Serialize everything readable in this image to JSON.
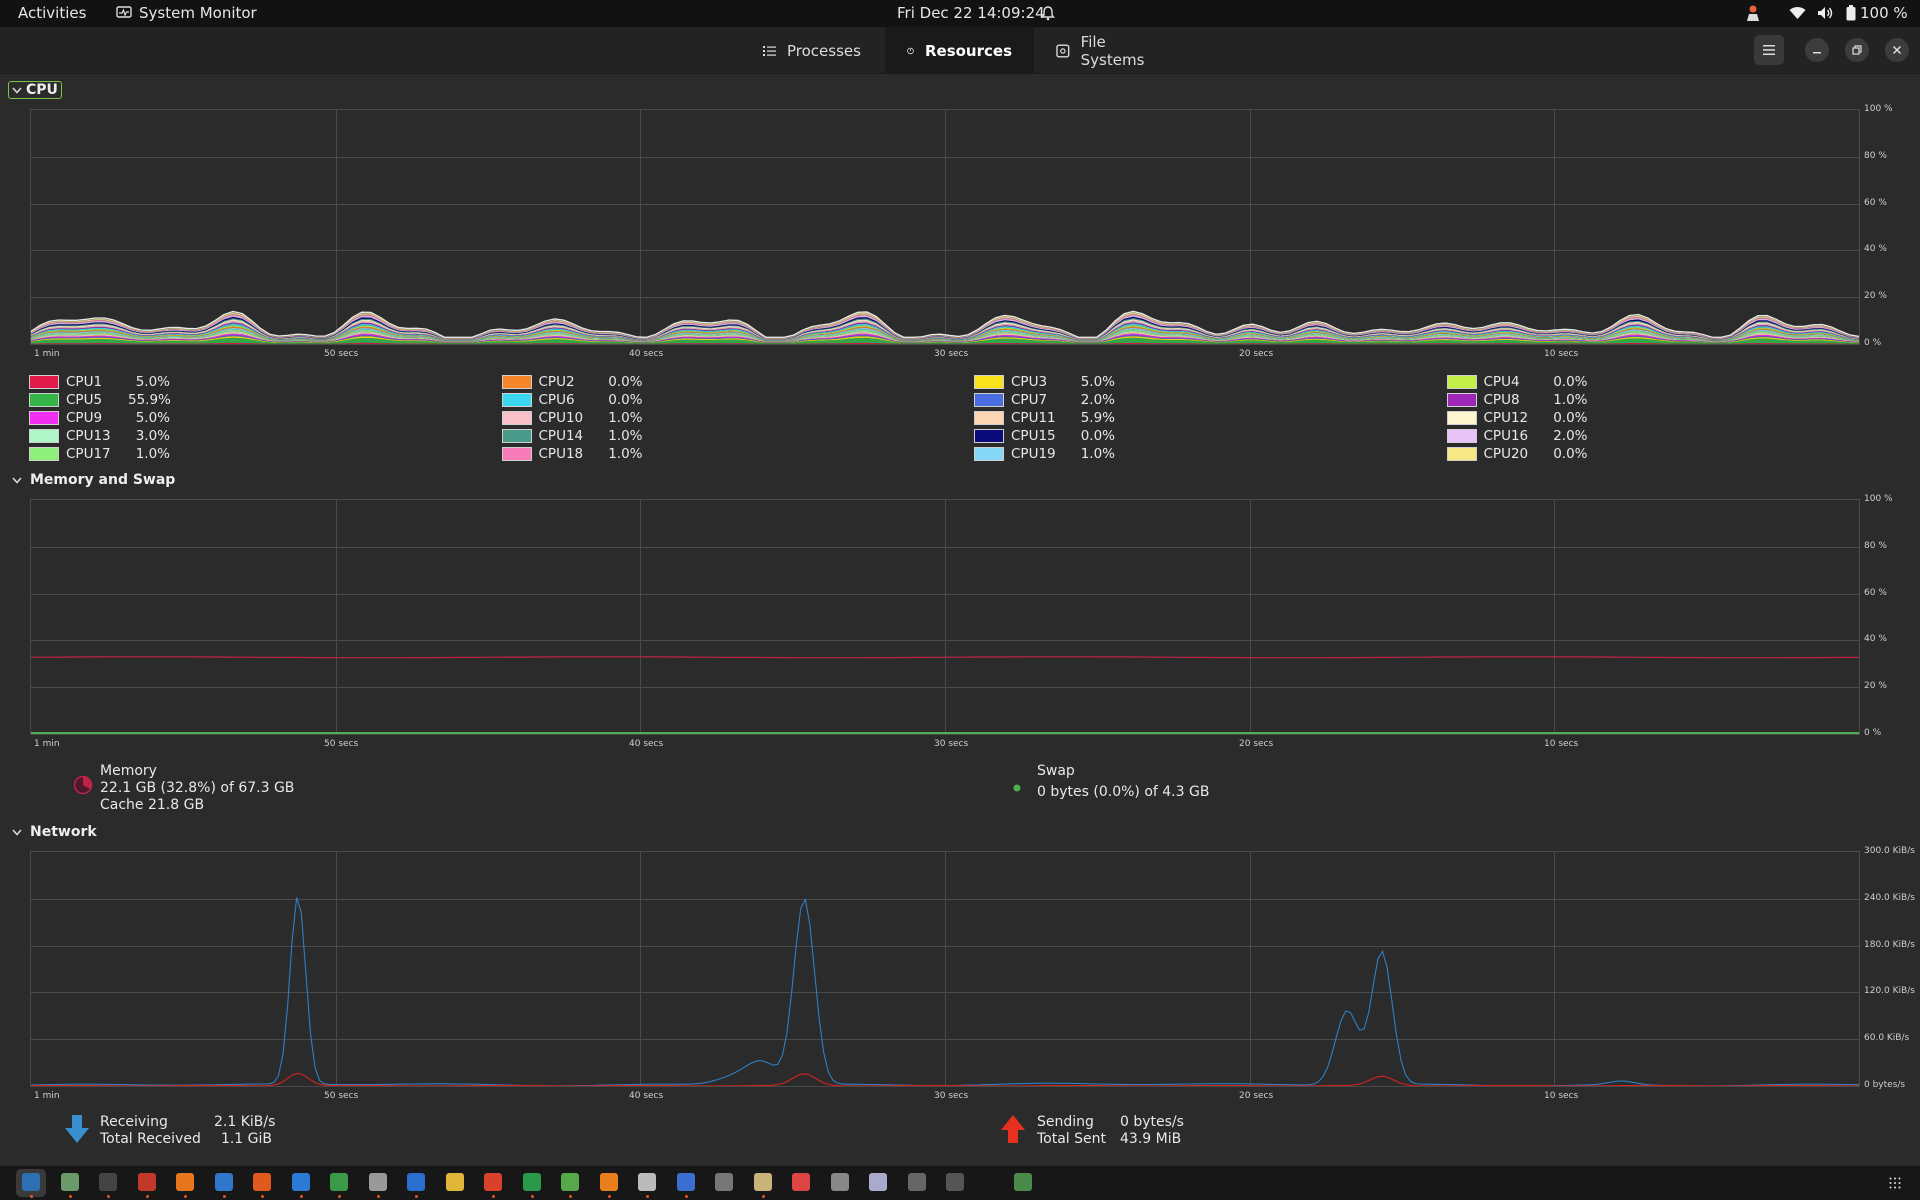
{
  "topbar": {
    "activities": "Activities",
    "app_name": "System Monitor",
    "datetime": "Fri Dec 22  14:09:24",
    "battery": "100 %"
  },
  "tabs": [
    {
      "label": "Processes"
    },
    {
      "label": "Resources"
    },
    {
      "label": "File Systems"
    }
  ],
  "sections": {
    "cpu": "CPU",
    "memory": "Memory and Swap",
    "network": "Network"
  },
  "axes": {
    "x_ticks": [
      "1 min",
      "50 secs",
      "40 secs",
      "30 secs",
      "20 secs",
      "10 secs"
    ],
    "pct_ticks": [
      "100 %",
      "80 %",
      "60 %",
      "40 %",
      "20 %",
      "0 %"
    ],
    "net_ticks": [
      "300.0 KiB/s",
      "240.0 KiB/s",
      "180.0 KiB/s",
      "120.0 KiB/s",
      "60.0 KiB/s",
      "0 bytes/s"
    ]
  },
  "cpus": [
    {
      "name": "CPU1",
      "value": "5.0%",
      "color": "#e01b4c"
    },
    {
      "name": "CPU2",
      "value": "0.0%",
      "color": "#f5862a"
    },
    {
      "name": "CPU3",
      "value": "5.0%",
      "color": "#f8e21b"
    },
    {
      "name": "CPU4",
      "value": "0.0%",
      "color": "#c4ef48"
    },
    {
      "name": "CPU5",
      "value": "55.9%",
      "color": "#33b54a"
    },
    {
      "name": "CPU6",
      "value": "0.0%",
      "color": "#3ad7f1"
    },
    {
      "name": "CPU7",
      "value": "2.0%",
      "color": "#4a6ee0"
    },
    {
      "name": "CPU8",
      "value": "1.0%",
      "color": "#9c27b8"
    },
    {
      "name": "CPU9",
      "value": "5.0%",
      "color": "#f02ff0"
    },
    {
      "name": "CPU10",
      "value": "1.0%",
      "color": "#f8c0c8"
    },
    {
      "name": "CPU11",
      "value": "5.9%",
      "color": "#fbd5b4"
    },
    {
      "name": "CPU12",
      "value": "0.0%",
      "color": "#fdf6cf"
    },
    {
      "name": "CPU13",
      "value": "3.0%",
      "color": "#b0f5c8"
    },
    {
      "name": "CPU14",
      "value": "1.0%",
      "color": "#4a9a8a"
    },
    {
      "name": "CPU15",
      "value": "0.0%",
      "color": "#0a0a7a"
    },
    {
      "name": "CPU16",
      "value": "2.0%",
      "color": "#e8c4f8"
    },
    {
      "name": "CPU17",
      "value": "1.0%",
      "color": "#8ef07a"
    },
    {
      "name": "CPU18",
      "value": "1.0%",
      "color": "#f77cb8"
    },
    {
      "name": "CPU19",
      "value": "1.0%",
      "color": "#86d6f7"
    },
    {
      "name": "CPU20",
      "value": "0.0%",
      "color": "#f7ea86"
    }
  ],
  "memory": {
    "label": "Memory",
    "usage": "22.1 GB (32.8%) of 67.3 GB",
    "cache": "Cache 21.8 GB",
    "fraction": 0.328
  },
  "swap": {
    "label": "Swap",
    "usage": "0 bytes (0.0%) of 4.3 GB",
    "fraction": 0.0
  },
  "network": {
    "receiving_label": "Receiving",
    "receiving_value": "2.1 KiB/s",
    "total_received_label": "Total Received",
    "total_received_value": "1.1 GiB",
    "sending_label": "Sending",
    "sending_value": "0 bytes/s",
    "total_sent_label": "Total Sent",
    "total_sent_value": "43.9 MiB"
  },
  "colors": {
    "memory_line": "#c0234a",
    "swap_line": "#4caf50",
    "receiving_line": "#2e7fc4",
    "sending_line": "#d6231e"
  }
}
